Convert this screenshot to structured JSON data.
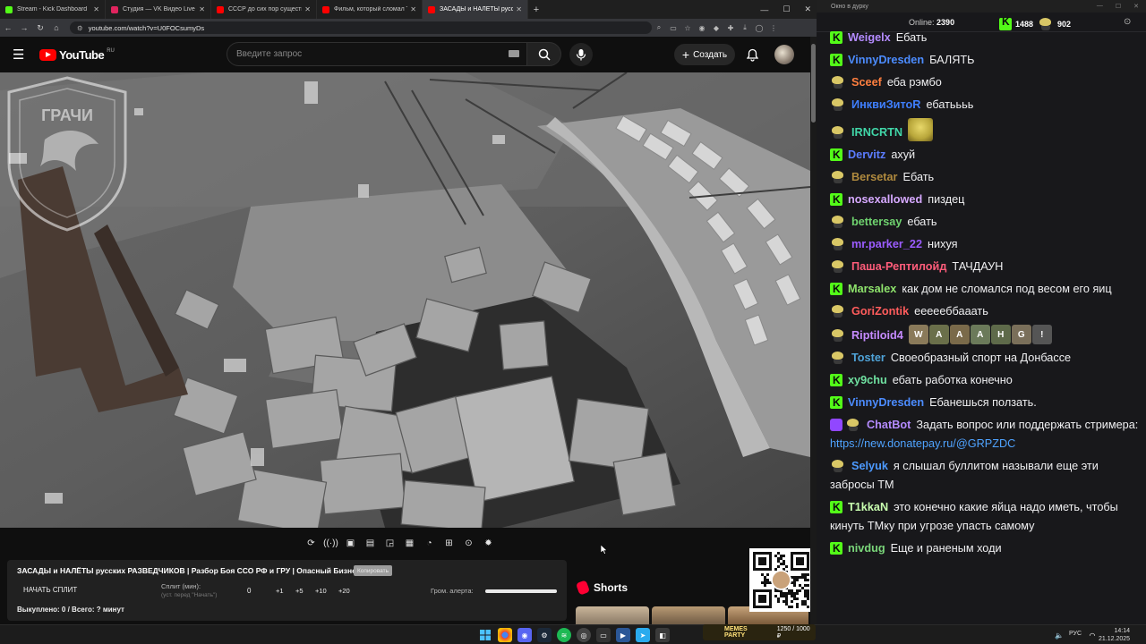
{
  "browser": {
    "tabs": [
      {
        "title": "Stream - Kick Dashboard",
        "color": "#53fc18"
      },
      {
        "title": "Студия — VK Видео Live",
        "color": "#e0245e"
      },
      {
        "title": "СССР до сих пор существует",
        "color": "#ff0000"
      },
      {
        "title": "Фильм, который сломал Томс",
        "color": "#ff0000"
      },
      {
        "title": "ЗАСАДЫ и НАЛЁТЫ русск",
        "color": "#ff0000"
      }
    ],
    "url": "youtube.com/watch?v=U0FOCsumyDs"
  },
  "youtube": {
    "logo_text": "YouTube",
    "logo_region": "RU",
    "search_placeholder": "Введите запрос",
    "create_label": "Создать",
    "video_watermark": "ГРАЧИ",
    "watermark_ring": "ОТРЯД СПЕЦИАЛЬНОГО НАЗНАЧЕНИЯ",
    "info": {
      "title": "ЗАСАДЫ и НАЛЁТЫ русских РАЗВЕДЧИКОВ | Разбор Боя ССО РФ и ГРУ | Опасный Бизнес",
      "copy_label": "Копировать",
      "split_button": "НАЧАТЬ СПЛИТ",
      "split_label": "Сплит (мин):",
      "split_sub": "(уст. перед \"Начать\")",
      "split_value": "0",
      "plus_buttons": [
        "+1",
        "+5",
        "+10",
        "+20"
      ],
      "alert_label": "Гром. алерта:",
      "alert_level": 1.0,
      "killed": "Выкуплено: 0 / Всего: ? минут"
    },
    "shorts_label": "Shorts"
  },
  "chat": {
    "window_title": "Окно в дурку",
    "online_label": "Online:",
    "online_count": "2390",
    "kick_count": "1488",
    "other_count": "902",
    "messages": [
      {
        "badge": "kick",
        "user": "Weigelx",
        "color": "#b48bff",
        "text": "Ебать"
      },
      {
        "badge": "kick",
        "user": "VinnyDresden",
        "color": "#4c8cff",
        "text": "БАЛЯТЬ"
      },
      {
        "badge": "pepe",
        "user": "Sceef",
        "color": "#ff7f3f",
        "text": "еба рэмбо"
      },
      {
        "badge": "pepe",
        "user": "ИнквиЗитоR",
        "color": "#3f7fff",
        "text": "ебатьььь"
      },
      {
        "badge": "pepe",
        "user": "IRNCRTN",
        "color": "#41d6a8",
        "text": "",
        "emote": "pepe-emote"
      },
      {
        "badge": "kick",
        "user": "Dervitz",
        "color": "#5b7cff",
        "text": "ахуй"
      },
      {
        "badge": "pepe",
        "user": "Bersetar",
        "color": "#b08a3e",
        "text": "Ебать"
      },
      {
        "badge": "kick",
        "user": "nosexallowed",
        "color": "#d6a9ff",
        "text": "пиздец"
      },
      {
        "badge": "pepe",
        "user": "bettersay",
        "color": "#6fd36f",
        "text": "ебать"
      },
      {
        "badge": "pepe",
        "user": "mr.parker_22",
        "color": "#9b5cff",
        "text": "нихуя"
      },
      {
        "badge": "pepe",
        "user": "Паша-Рептилойд",
        "color": "#ff5c7a",
        "text": "ТАЧДАУН"
      },
      {
        "badge": "kick",
        "user": "Marsalex",
        "color": "#8ee36c",
        "text": "как дом не сломался под весом его яиц"
      },
      {
        "badge": "pepe",
        "user": "GoriZontik",
        "color": "#ff5c5c",
        "text": "еееееббааать"
      },
      {
        "badge": "pepe",
        "user": "Riptiloid4",
        "color": "#c68bff",
        "text": "",
        "emote_row": [
          "W",
          "A",
          "A",
          "A",
          "H",
          "G",
          "!"
        ]
      },
      {
        "badge": "pepe",
        "user": "Toster",
        "color": "#4fa3d8",
        "text": "Своеобразный спорт на Донбассе"
      },
      {
        "badge": "kick",
        "user": "xy9chu",
        "color": "#6fe0a0",
        "text": "ебать работка конечно"
      },
      {
        "badge": "kick",
        "user": "VinnyDresden",
        "color": "#4c8cff",
        "text": "Ебанешься ползать."
      },
      {
        "badge": "bot",
        "user": "ChatBot",
        "color": "#b48bff",
        "text": "Задать вопрос или поддержать стримера:",
        "link": "https://new.donatepay.ru/@GRPZDC"
      },
      {
        "badge": "pepe",
        "user": "Selyuk",
        "color": "#4c9aff",
        "text": "я слышал буллитом называли еще эти забросы ТМ"
      },
      {
        "badge": "kick",
        "user": "T1kkaN",
        "color": "#c9ffb0",
        "text": "это конечно какие яйца надо иметь, чтобы кинуть ТМку при угрозе упасть самому"
      },
      {
        "badge": "kick",
        "user": "nivdug",
        "color": "#7ad67a",
        "text": "Еще и раненым ходи"
      }
    ]
  },
  "taskbar": {
    "lang": "РУС",
    "time": "14:14",
    "date": "21.12.2025",
    "donate_banner": "MEMES PARTY",
    "donate_progress": "1250 / 1000 ₽"
  }
}
